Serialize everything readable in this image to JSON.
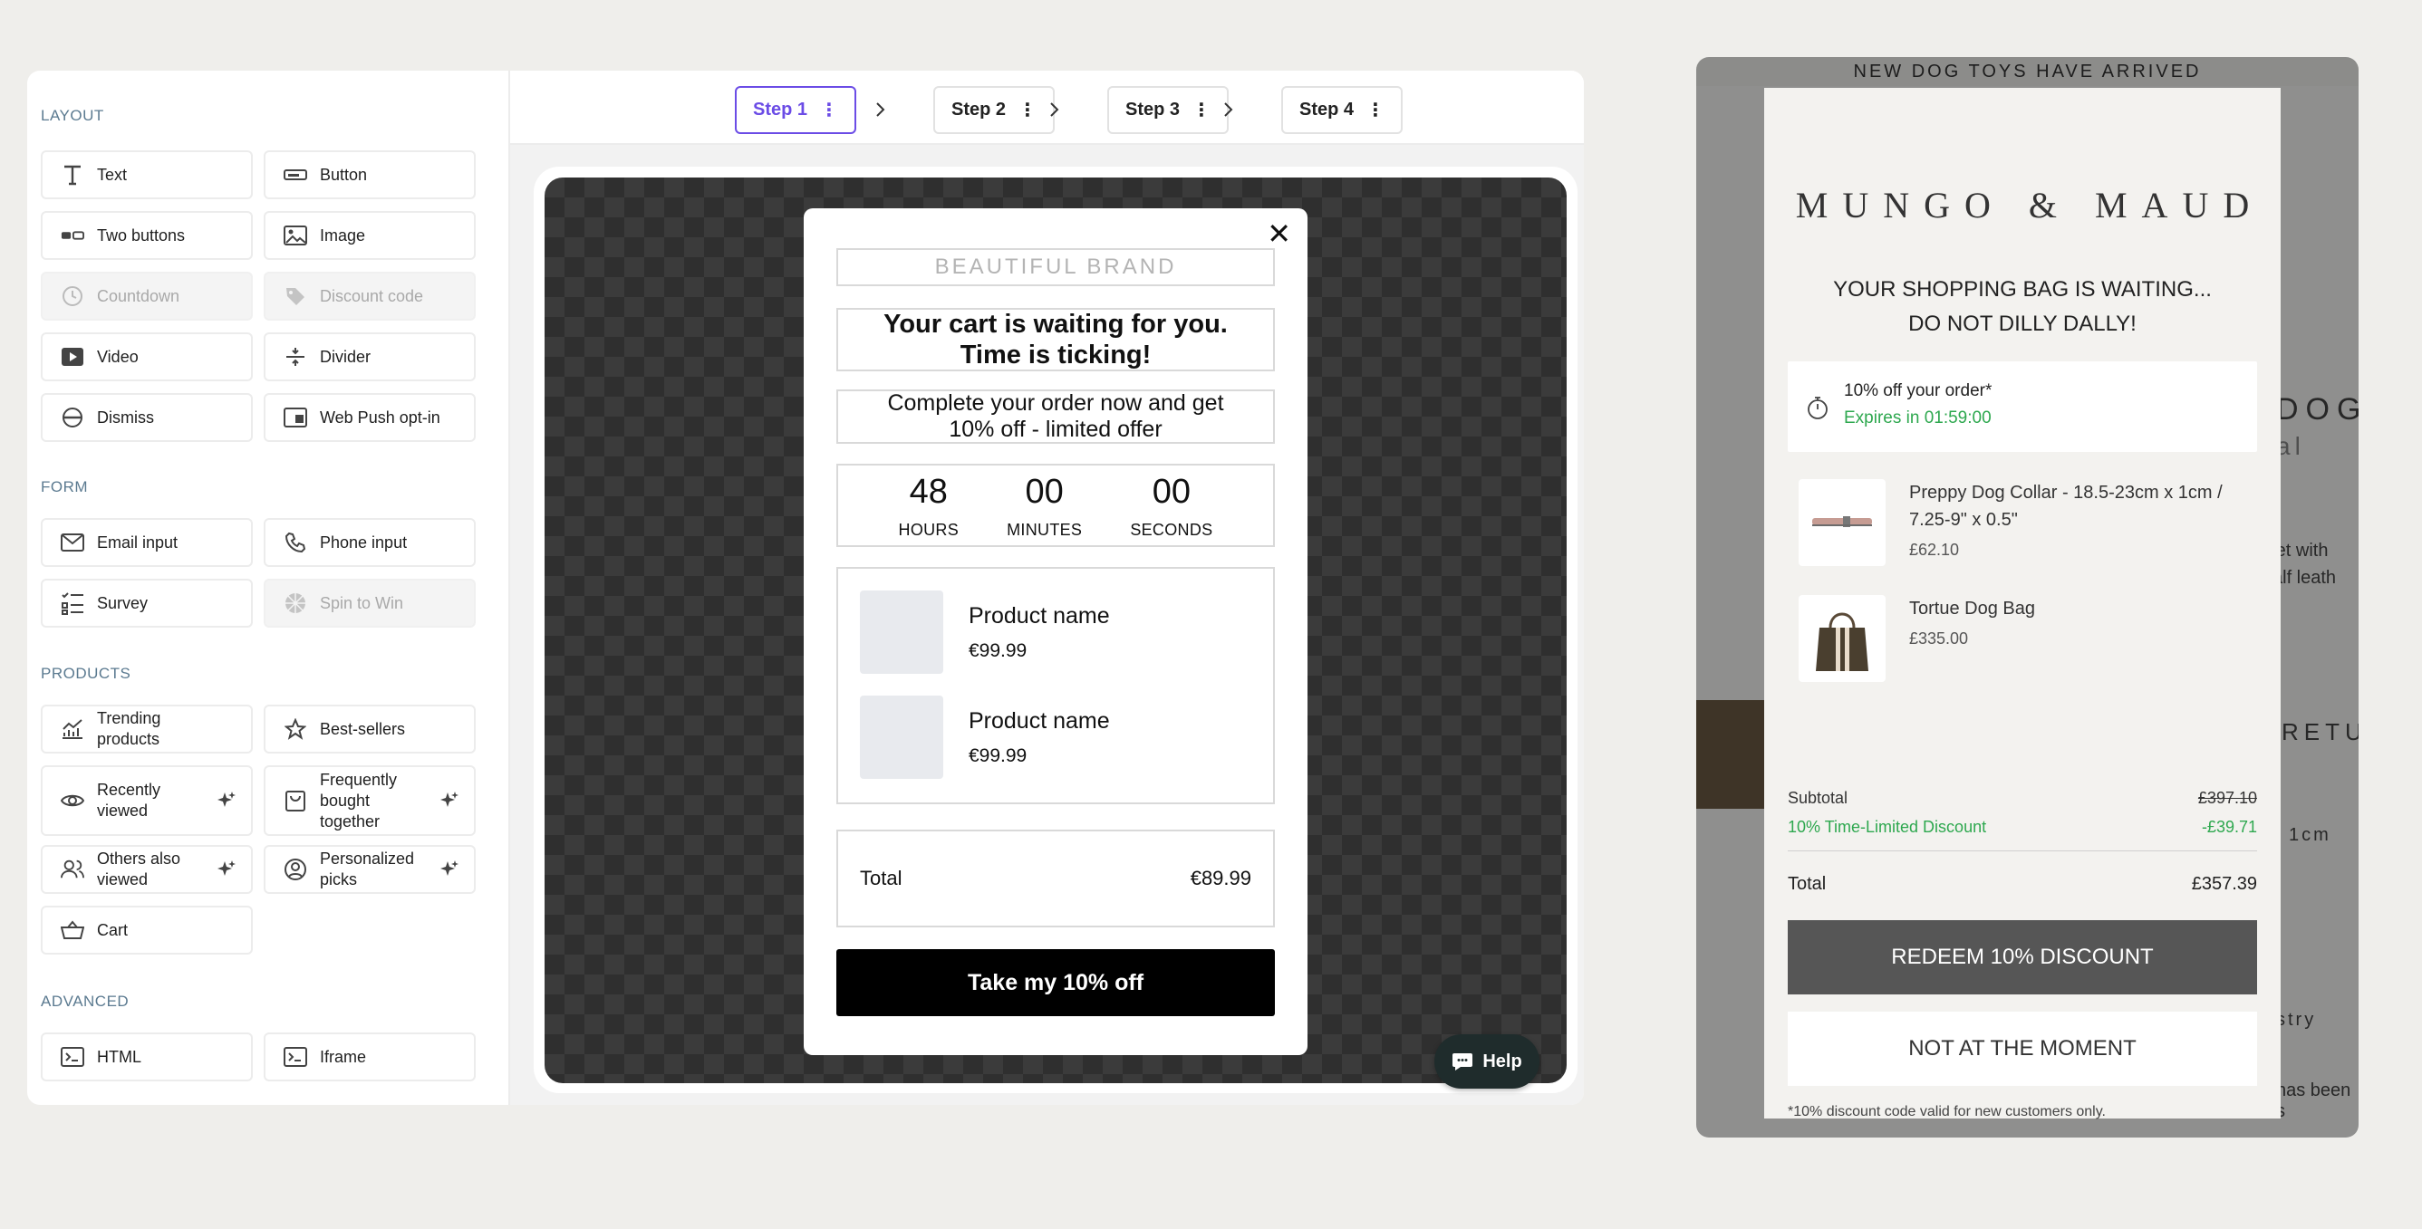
{
  "sidebar": {
    "sections": {
      "layout": "LAYOUT",
      "form": "FORM",
      "products": "PRODUCTS",
      "advanced": "ADVANCED"
    },
    "blocks": {
      "text": "Text",
      "button": "Button",
      "two_buttons": "Two buttons",
      "image": "Image",
      "countdown": "Countdown",
      "discount_code": "Discount code",
      "video": "Video",
      "divider": "Divider",
      "dismiss": "Dismiss",
      "web_push": "Web Push opt-in",
      "email_input": "Email input",
      "phone_input": "Phone input",
      "survey": "Survey",
      "spin_to_win": "Spin to Win",
      "trending_1": "Trending",
      "trending_2": "products",
      "best_sellers": "Best-sellers",
      "recently_1": "Recently",
      "recently_2": "viewed",
      "fbt_1": "Frequently",
      "fbt_2": "bought",
      "fbt_3": "together",
      "others_1": "Others also",
      "others_2": "viewed",
      "personalized_1": "Personalized",
      "personalized_2": "picks",
      "cart": "Cart",
      "html": "HTML",
      "iframe": "Iframe"
    }
  },
  "steps": [
    "Step 1",
    "Step 2",
    "Step 3",
    "Step 4"
  ],
  "step_menu_glyph": "⋮",
  "accent_color": "#6b4ce6",
  "popup": {
    "close": "✕",
    "brand": "BEAUTIFUL BRAND",
    "headline": "Your cart is waiting for you. Time is ticking!",
    "subline": "Complete your order now and get 10% off - limited offer",
    "timer": {
      "hours": "48",
      "hours_label": "HOURS",
      "minutes": "00",
      "minutes_label": "MINUTES",
      "seconds": "00",
      "seconds_label": "SECONDS"
    },
    "products": [
      {
        "name": "Product name",
        "price": "€99.99"
      },
      {
        "name": "Product name",
        "price": "€99.99"
      }
    ],
    "total_label": "Total",
    "total_value": "€89.99",
    "cta": "Take my 10% off"
  },
  "help_label": "Help",
  "preview": {
    "announcement": "NEW DOG TOYS HAVE ARRIVED",
    "bg_fragments": [
      "DOG",
      "al",
      "e set with",
      "calf leath",
      "RETUR",
      "1cm",
      "stry",
      "has been s"
    ],
    "logo": "MUNGO & MAUD",
    "title_line1": "YOUR SHOPPING BAG IS WAITING...",
    "title_line2": "DO NOT DILLY DALLY!",
    "offer_text": "10% off your order*",
    "offer_expiry": "Expires in 01:59:00",
    "items": [
      {
        "name": "Preppy Dog Collar - 18.5-23cm x 1cm / 7.25-9\" x 0.5\"",
        "price": "£62.10"
      },
      {
        "name": "Tortue Dog Bag",
        "price": "£335.00"
      }
    ],
    "subtotal_label": "Subtotal",
    "subtotal_value": "£397.10",
    "discount_label": "10% Time-Limited Discount",
    "discount_value": "-£39.71",
    "total_label": "Total",
    "total_value": "£357.39",
    "redeem": "REDEEM 10% DISCOUNT",
    "decline": "NOT AT THE MOMENT",
    "footnote": "*10% discount code valid for new customers only.",
    "discount_color": "#2ea84f"
  }
}
